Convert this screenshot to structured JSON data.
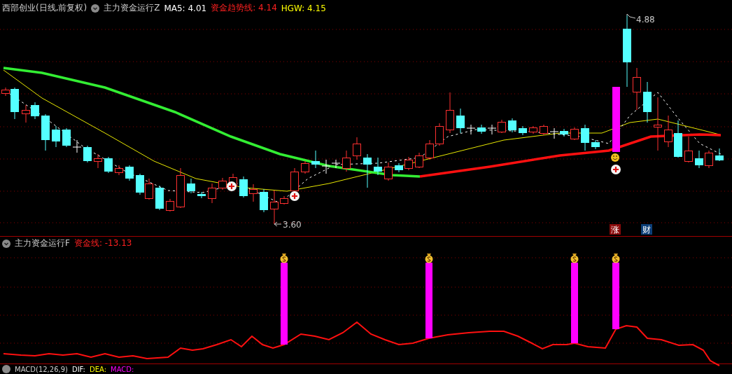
{
  "main_panel": {
    "title": "西部创业(日线,前复权)",
    "indicator": "主力资金运行Z",
    "readings": [
      {
        "label": "MA5:",
        "value": "4.01",
        "color": "#ffffff"
      },
      {
        "label": "资金趋势线:",
        "value": "4.14",
        "color": "#ff2020"
      },
      {
        "label": "HGW:",
        "value": "4.15",
        "color": "#ffff00"
      }
    ],
    "high_label": "4.88",
    "low_label": "3.60",
    "signals": [
      {
        "text": "涨",
        "color": "#8b0a0a"
      },
      {
        "text": "财",
        "color": "#0d3f78"
      }
    ]
  },
  "sub_panel": {
    "indicator": "主力资金运行F",
    "readings": [
      {
        "label": "资金线:",
        "value": "-13.13",
        "color": "#ff2020"
      }
    ]
  },
  "macd_panel": {
    "indicator": "MACD(12,26,9)",
    "readings": [
      {
        "label": "DIF:",
        "color": "#ffffff"
      },
      {
        "label": "DEA:",
        "color": "#ffff00"
      },
      {
        "label": "MACD:",
        "color": "#ff00ff"
      }
    ]
  }
}
